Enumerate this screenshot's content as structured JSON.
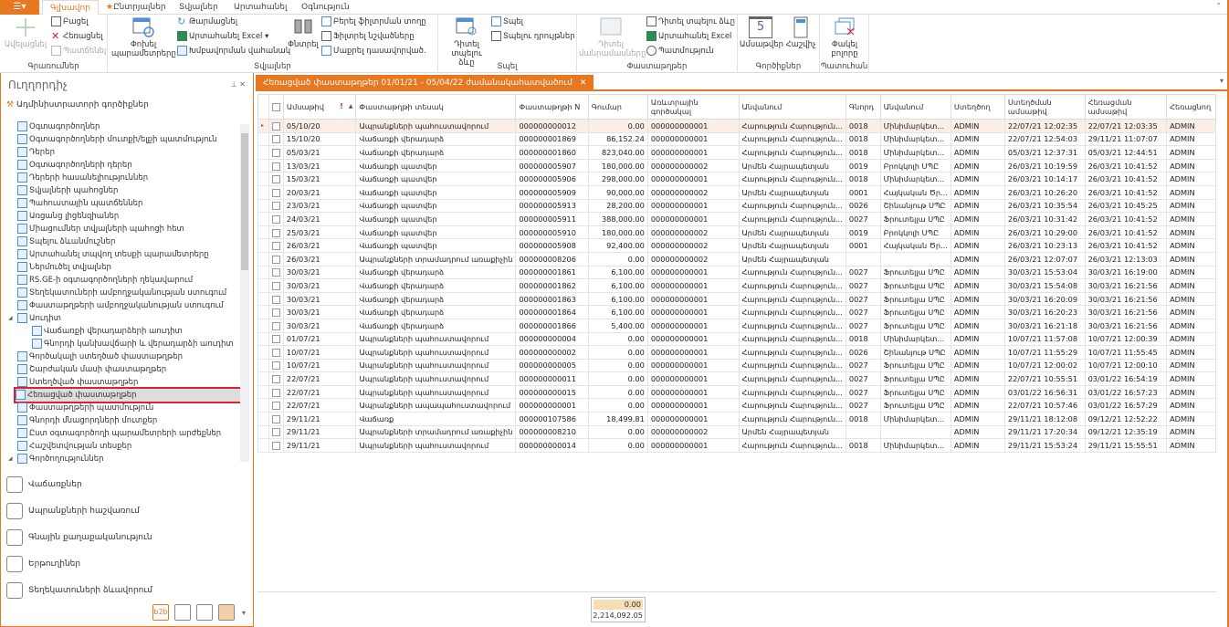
{
  "app_menu_icon": "app-menu-icon",
  "tabs": [
    {
      "label": "Գլխավոր",
      "active": true
    },
    {
      "label": "Ընտրյալներ",
      "icon": "star-icon"
    },
    {
      "label": "Տվյալներ"
    },
    {
      "label": "Արտահանել"
    },
    {
      "label": "Օգնություն"
    }
  ],
  "ribbon": {
    "groups": {
      "records": {
        "label": "Գրառումներ",
        "add": "Ավելացնել",
        "open": "Բացել",
        "delete": "Հեռացնել",
        "copy": "Պատճենել"
      },
      "data": {
        "label": "Տվյալներ",
        "change_params": "Փոխել պարամետրերը",
        "refresh": "Թարմացնել",
        "export_excel": "Արտահանել Excel",
        "group_panel": "Խմբավորման վահանակ",
        "find": "Փնտրել",
        "filter_row": "Բերել ֆիլտրման տողը",
        "filter_marks": "Ֆիլտրել նշվածները",
        "clear_sort": "Մաքրել դասավորված."
      },
      "print": {
        "label": "Տպել",
        "preview": "Դիտել տպելու ձևը",
        "print": "Տպել",
        "print_settings": "Տպելու դրույթներ"
      },
      "documents": {
        "label": "Փաստաթղթեր",
        "view_details": "Դիտել մանրամասները",
        "view_print_form": "Դիտել տպելու ձևը",
        "export_excel": "Արտահանել Excel",
        "history": "Պատմություն"
      },
      "tools": {
        "label": "Գործիքներ",
        "calendar": "Ամսաթվեր",
        "calendar_day": "5",
        "calculator": "Հաշվիչ"
      },
      "window": {
        "label": "Պատուհան",
        "close_all": "Փակել բոլորը"
      }
    }
  },
  "left_panel": {
    "title": "Ուղղորդիչ",
    "admin_section": "Ադմինիստրատորի գործիքներ",
    "tree": [
      {
        "label": "Օգտագործողներ",
        "level": 1,
        "icon": "user-add-icon"
      },
      {
        "label": "Օգտագործողների մուտքի/ելքի պատմություն",
        "level": 1,
        "icon": "users-history-icon"
      },
      {
        "label": "Դերեր",
        "level": 1,
        "icon": "table-icon"
      },
      {
        "label": "Օգտագործողների դերեր",
        "level": 1,
        "icon": "table-icon"
      },
      {
        "label": "Դերերի հասանելիություններ",
        "level": 1,
        "icon": "table-icon"
      },
      {
        "label": "Տվյալների պահոցներ",
        "level": 1,
        "icon": "database-icon"
      },
      {
        "label": "Պահուստային պատճեններ",
        "level": 1,
        "icon": "backup-icon"
      },
      {
        "label": "Առցանց լիցենզիաներ",
        "level": 1,
        "icon": "monitor-icon"
      },
      {
        "label": "Միացումներ տվյալների պահոցի հետ",
        "level": 1,
        "icon": "connection-icon"
      },
      {
        "label": "Տպելու ձևանմուշներ",
        "level": 1,
        "icon": "print-template-icon"
      },
      {
        "label": "Արտահանել տպվող տեսքի պարամետրերը",
        "level": 1,
        "icon": "export-icon"
      },
      {
        "label": "Ներմուծել տվյալներ",
        "level": 1,
        "icon": "import-icon"
      },
      {
        "label": "RS.GE-ի օգտագործողների ղեկավարում",
        "level": 1,
        "icon": "rsge-icon"
      },
      {
        "label": "Տեղեկատուների ամբողջականության ստուգում",
        "level": 1,
        "icon": "warning-db-icon"
      },
      {
        "label": "Փաստաթղթերի ամբողջականության ստուգում",
        "level": 1,
        "icon": "warning-db-icon"
      },
      {
        "label": "Աուդիտ",
        "level": 1,
        "icon": "table-icon",
        "expanded": true
      },
      {
        "label": "Վաճառքի վերադարձերի աուդիտ",
        "level": 2,
        "icon": "table-icon"
      },
      {
        "label": "Գնորդի կանխավճարի և վերադարձի աուդիտ",
        "level": 2,
        "icon": "table-icon"
      },
      {
        "label": "Գործակալի ստեղծած փաստաթղթեր",
        "level": 1,
        "icon": "list-icon"
      },
      {
        "label": "Շարժական մասի փաստաթղթեր",
        "level": 1,
        "icon": "list-icon"
      },
      {
        "label": "Ստեղծված փաստաթղթեր",
        "level": 1,
        "icon": "list-icon"
      },
      {
        "label": "Հեռացված փաստաթղթեր",
        "level": 1,
        "icon": "list-icon",
        "selected": true
      },
      {
        "label": "Փաստաթղթերի պատմություն",
        "level": 1,
        "icon": "list-icon"
      },
      {
        "label": "Գնորդի մնացորդների մուտքեր",
        "level": 1,
        "icon": "list-icon"
      },
      {
        "label": "Ըստ օգտագործողի պարամետրերի արժեքներ",
        "level": 1,
        "icon": "list-icon"
      },
      {
        "label": "Հաշվետվության տեսքեր",
        "level": 1,
        "icon": "table-icon"
      },
      {
        "label": "Գործողություններ",
        "level": 1,
        "icon": "operations-icon",
        "expanded": true
      }
    ],
    "nav_buttons": [
      {
        "label": "Վաճառքներ",
        "icon": "sales-chart-icon"
      },
      {
        "label": "Ապրանքների հաշվառում",
        "icon": "inventory-box-icon"
      },
      {
        "label": "Գնային քաղաքականություն",
        "icon": "price-tag-icon"
      },
      {
        "label": "Երթուղիներ",
        "icon": "route-pin-icon"
      },
      {
        "label": "Տեղեկատուների ձևավորում",
        "icon": "reference-setup-icon"
      }
    ],
    "bottom_icons": [
      {
        "name": "b2b-icon",
        "label": "b2b"
      },
      {
        "name": "clipboard-icon",
        "label": ""
      },
      {
        "name": "user-phone-icon",
        "label": ""
      },
      {
        "name": "admin-tools-icon",
        "label": ""
      }
    ]
  },
  "document_tab": {
    "title": "Հեռացված փաստաթղթեր 01/01/21 - 05/04/22 ժամանակահատվածում"
  },
  "table": {
    "columns": [
      "Ամսաթիվ",
      "Փաստաթղթի տեսակ",
      "Փաստաթղթի N",
      "Գումար",
      "Առևտրային գործակալ",
      "Անվանում",
      "Գնորդ",
      "Անվանում",
      "Ստեղծող",
      "Ստեղծման ամսաթիվ",
      "Հեռացման ամսաթիվ",
      "Հեռացնող"
    ],
    "sort_column": "Ամսաթիվ",
    "sort_direction": "asc",
    "rows": [
      [
        "05/10/20",
        "Ապրանքների պահուստավորում",
        "000000000012",
        "0.00",
        "000000000001",
        "Հարություն Հարություն...",
        "0018",
        "Մինիմարկետ...",
        "ADMIN",
        "22/07/21 12:02:35",
        "22/07/21 12:03:35",
        "ADMIN"
      ],
      [
        "15/10/20",
        "Վաճառքի վերադարձ",
        "000000001869",
        "86,152.24",
        "000000000001",
        "Հարություն Հարություն...",
        "0018",
        "Մինիմարկետ...",
        "ADMIN",
        "22/07/21 12:54:03",
        "29/11/21 11:07:07",
        "ADMIN"
      ],
      [
        "05/03/21",
        "Վաճառքի վերադարձ",
        "000000001860",
        "823,040.00",
        "000000000001",
        "Հարություն Հարություն...",
        "0018",
        "Մինիմարկետ...",
        "ADMIN",
        "05/03/21 12:37:31",
        "05/03/21 12:44:51",
        "ADMIN"
      ],
      [
        "13/03/21",
        "Վաճառքի պատվեր",
        "000000005907",
        "180,000.00",
        "000000000002",
        "Արմեն Հայրապետյան",
        "0019",
        "Բրոկկոլի ՍՊԸ",
        "ADMIN",
        "26/03/21 10:19:59",
        "26/03/21 10:41:52",
        "ADMIN"
      ],
      [
        "15/03/21",
        "Վաճառքի պատվեր",
        "000000005906",
        "298,000.00",
        "000000000001",
        "Հարություն Հարություն...",
        "0018",
        "Մինիմարկետ...",
        "ADMIN",
        "26/03/21 10:14:17",
        "26/03/21 10:41:52",
        "ADMIN"
      ],
      [
        "20/03/21",
        "Վաճառքի պատվեր",
        "000000005909",
        "90,000.00",
        "000000000002",
        "Արմեն Հայրապետյան",
        "0001",
        "Հայկական Ծր...",
        "ADMIN",
        "26/03/21 10:26:20",
        "26/03/21 10:41:52",
        "ADMIN"
      ],
      [
        "23/03/21",
        "Վաճառքի պատվեր",
        "000000005913",
        "28,200.00",
        "000000000001",
        "Հարություն Հարություն...",
        "0026",
        "Շինանյութ ՍՊԸ",
        "ADMIN",
        "26/03/21 10:35:54",
        "26/03/21 10:45:25",
        "ADMIN"
      ],
      [
        "24/03/21",
        "Վաճառքի պատվեր",
        "000000005911",
        "388,000.00",
        "000000000001",
        "Հարություն Հարություն...",
        "0027",
        "Ֆրուտելլա ՍՊԸ",
        "ADMIN",
        "26/03/21 10:31:42",
        "26/03/21 10:41:52",
        "ADMIN"
      ],
      [
        "25/03/21",
        "Վաճառքի պատվեր",
        "000000005910",
        "180,000.00",
        "000000000002",
        "Արմեն Հայրապետյան",
        "0019",
        "Բրոկկոլի ՍՊԸ",
        "ADMIN",
        "26/03/21 10:29:00",
        "26/03/21 10:41:52",
        "ADMIN"
      ],
      [
        "26/03/21",
        "Վաճառքի պատվեր",
        "000000005908",
        "92,400.00",
        "000000000002",
        "Արմեն Հայրապետյան",
        "0001",
        "Հայկական Ծր...",
        "ADMIN",
        "26/03/21 10:23:13",
        "26/03/21 10:41:52",
        "ADMIN"
      ],
      [
        "26/03/21",
        "Ապրանքների տրամադրում առաքիչին",
        "000000008206",
        "0.00",
        "000000000002",
        "Արմեն Հայրապետյան",
        "",
        "",
        "ADMIN",
        "26/03/21 12:07:07",
        "26/03/21 12:13:03",
        "ADMIN"
      ],
      [
        "30/03/21",
        "Վաճառքի վերադարձ",
        "000000001861",
        "6,100.00",
        "000000000001",
        "Հարություն Հարություն...",
        "0027",
        "Ֆրուտելլա ՍՊԸ",
        "ADMIN",
        "30/03/21 15:53:04",
        "30/03/21 16:19:00",
        "ADMIN"
      ],
      [
        "30/03/21",
        "Վաճառքի վերադարձ",
        "000000001862",
        "6,100.00",
        "000000000001",
        "Հարություն Հարություն...",
        "0027",
        "Ֆրուտելլա ՍՊԸ",
        "ADMIN",
        "30/03/21 15:54:08",
        "30/03/21 16:21:56",
        "ADMIN"
      ],
      [
        "30/03/21",
        "Վաճառքի վերադարձ",
        "000000001863",
        "6,100.00",
        "000000000001",
        "Հարություն Հարություն...",
        "0027",
        "Ֆրուտելլա ՍՊԸ",
        "ADMIN",
        "30/03/21 16:20:09",
        "30/03/21 16:21:56",
        "ADMIN"
      ],
      [
        "30/03/21",
        "Վաճառքի վերադարձ",
        "000000001864",
        "6,100.00",
        "000000000001",
        "Հարություն Հարություն...",
        "0027",
        "Ֆրուտելլա ՍՊԸ",
        "ADMIN",
        "30/03/21 16:20:23",
        "30/03/21 16:21:56",
        "ADMIN"
      ],
      [
        "30/03/21",
        "Վաճառքի վերադարձ",
        "000000001866",
        "5,400.00",
        "000000000001",
        "Հարություն Հարություն...",
        "0027",
        "Ֆրուտելլա ՍՊԸ",
        "ADMIN",
        "30/03/21 16:21:18",
        "30/03/21 16:21:56",
        "ADMIN"
      ],
      [
        "01/07/21",
        "Ապրանքների պահուստավորում",
        "000000000004",
        "0.00",
        "000000000001",
        "Հարություն Հարություն...",
        "0018",
        "Մինիմարկետ...",
        "ADMIN",
        "10/07/21 11:57:08",
        "10/07/21 12:00:39",
        "ADMIN"
      ],
      [
        "10/07/21",
        "Ապրանքների պահուստավորում",
        "000000000002",
        "0.00",
        "000000000001",
        "Հարություն Հարություն...",
        "0026",
        "Շինանյութ ՍՊԸ",
        "ADMIN",
        "10/07/21 11:55:29",
        "10/07/21 11:55:45",
        "ADMIN"
      ],
      [
        "10/07/21",
        "Ապրանքների պահուստավորում",
        "000000000005",
        "0.00",
        "000000000001",
        "Հարություն Հարություն...",
        "0027",
        "Ֆրուտելլա ՍՊԸ",
        "ADMIN",
        "10/07/21 12:00:02",
        "10/07/21 12:00:10",
        "ADMIN"
      ],
      [
        "22/07/21",
        "Ապրանքների պահուստավորում",
        "000000000011",
        "0.00",
        "000000000001",
        "Հարություն Հարություն...",
        "0027",
        "Ֆրուտելլա ՍՊԸ",
        "ADMIN",
        "22/07/21 10:55:51",
        "03/01/22 16:54:19",
        "ADMIN"
      ],
      [
        "22/07/21",
        "Ապրանքների պահուստավորում",
        "000000000015",
        "0.00",
        "000000000001",
        "Հարություն Հարություն...",
        "0027",
        "Ֆրուտելլա ՍՊԸ",
        "ADMIN",
        "03/01/22 16:56:31",
        "03/01/22 16:57:23",
        "ADMIN"
      ],
      [
        "22/07/21",
        "Ապրանքների ապապահուստավորում",
        "000000000001",
        "0.00",
        "000000000001",
        "Հարություն Հարություն...",
        "0027",
        "Ֆրուտելլա ՍՊԸ",
        "ADMIN",
        "22/07/21 10:57:46",
        "03/01/22 16:57:29",
        "ADMIN"
      ],
      [
        "29/11/21",
        "Վաճառք",
        "000000107586",
        "18,499.81",
        "000000000001",
        "Հարություն Հարություն...",
        "0018",
        "Մինիմարկետ...",
        "ADMIN",
        "29/11/21 18:12:08",
        "09/12/21 12:52:22",
        "ADMIN"
      ],
      [
        "29/11/21",
        "Ապրանքների տրամադրում առաքիչին",
        "000000008210",
        "0.00",
        "000000000002",
        "Արմեն Հայրապետյան",
        "",
        "",
        "ADMIN",
        "29/11/21 17:20:34",
        "09/12/21 12:35:19",
        "ADMIN"
      ],
      [
        "29/11/21",
        "Ապրանքների պահուստավորում",
        "000000000014",
        "0.00",
        "000000000001",
        "Հարություն Հարություն...",
        "0018",
        "Մինիմարկետ...",
        "ADMIN",
        "29/11/21 15:53:24",
        "29/11/21 15:55:51",
        "ADMIN"
      ]
    ],
    "current_row": 0
  },
  "footer": {
    "sum_selected": "0.00",
    "sum_total": "2,214,092.05"
  },
  "colors": {
    "accent": "#e87722",
    "selection_outline": "#d9232d",
    "current_row": "#fbeee6",
    "sum_highlight": "#f5deb3"
  }
}
